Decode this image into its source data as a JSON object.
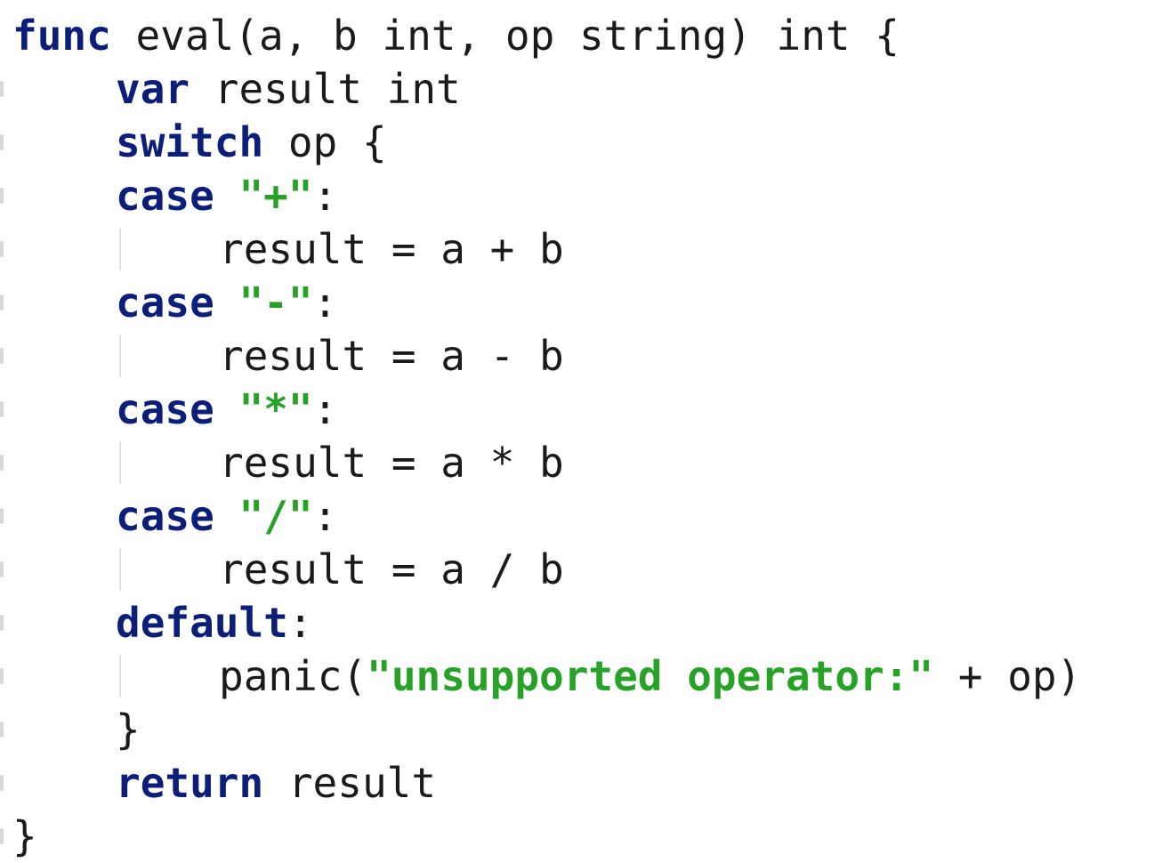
{
  "editor": {
    "language": "go",
    "colors": {
      "keyword": "#0b1f7a",
      "string": "#26a326",
      "text": "#1a1a1a",
      "background": "#ffffff",
      "indent_guide": "#e2e2e2"
    },
    "lines": [
      {
        "indent": 0,
        "tokens": [
          {
            "type": "kw",
            "text": "func"
          },
          {
            "type": "plain",
            "text": " eval(a, b int, op string) int {"
          }
        ]
      },
      {
        "indent": 1,
        "tokens": [
          {
            "type": "kw",
            "text": "var"
          },
          {
            "type": "plain",
            "text": " result int"
          }
        ]
      },
      {
        "indent": 1,
        "tokens": [
          {
            "type": "kw",
            "text": "switch"
          },
          {
            "type": "plain",
            "text": " op {"
          }
        ]
      },
      {
        "indent": 1,
        "tokens": [
          {
            "type": "kw",
            "text": "case"
          },
          {
            "type": "plain",
            "text": " "
          },
          {
            "type": "str",
            "text": "\"+\""
          },
          {
            "type": "plain",
            "text": ":"
          }
        ]
      },
      {
        "indent": 2,
        "tokens": [
          {
            "type": "plain",
            "text": "result = a + b"
          }
        ]
      },
      {
        "indent": 1,
        "tokens": [
          {
            "type": "kw",
            "text": "case"
          },
          {
            "type": "plain",
            "text": " "
          },
          {
            "type": "str",
            "text": "\"-\""
          },
          {
            "type": "plain",
            "text": ":"
          }
        ]
      },
      {
        "indent": 2,
        "tokens": [
          {
            "type": "plain",
            "text": "result = a - b"
          }
        ]
      },
      {
        "indent": 1,
        "tokens": [
          {
            "type": "kw",
            "text": "case"
          },
          {
            "type": "plain",
            "text": " "
          },
          {
            "type": "str",
            "text": "\"*\""
          },
          {
            "type": "plain",
            "text": ":"
          }
        ]
      },
      {
        "indent": 2,
        "tokens": [
          {
            "type": "plain",
            "text": "result = a * b"
          }
        ]
      },
      {
        "indent": 1,
        "tokens": [
          {
            "type": "kw",
            "text": "case"
          },
          {
            "type": "plain",
            "text": " "
          },
          {
            "type": "str",
            "text": "\"/\""
          },
          {
            "type": "plain",
            "text": ":"
          }
        ]
      },
      {
        "indent": 2,
        "tokens": [
          {
            "type": "plain",
            "text": "result = a / b"
          }
        ]
      },
      {
        "indent": 1,
        "tokens": [
          {
            "type": "kw",
            "text": "default"
          },
          {
            "type": "plain",
            "text": ":"
          }
        ]
      },
      {
        "indent": 2,
        "tokens": [
          {
            "type": "plain",
            "text": "panic("
          },
          {
            "type": "str",
            "text": "\"unsupported operator:\""
          },
          {
            "type": "plain",
            "text": " + op)"
          }
        ]
      },
      {
        "indent": 1,
        "tokens": [
          {
            "type": "plain",
            "text": "}"
          }
        ]
      },
      {
        "indent": 1,
        "tokens": [
          {
            "type": "kw",
            "text": "return"
          },
          {
            "type": "plain",
            "text": " result"
          }
        ]
      },
      {
        "indent": 0,
        "tokens": [
          {
            "type": "plain",
            "text": "}"
          }
        ]
      }
    ]
  }
}
